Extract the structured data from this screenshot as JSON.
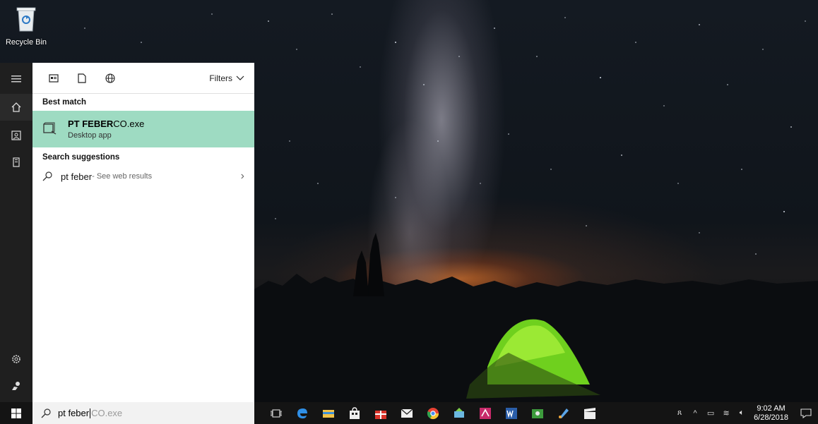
{
  "desktop": {
    "recycle_bin_label": "Recycle Bin"
  },
  "search_panel": {
    "toolbar": {
      "filters_label": "Filters",
      "icons": [
        "apps-icon",
        "documents-icon",
        "web-icon"
      ]
    },
    "best_match": {
      "section_title": "Best match",
      "app_name_bold": "PT FEBER",
      "app_name_rest": "CO.exe",
      "app_type": "Desktop app"
    },
    "suggestions": {
      "section_title": "Search suggestions",
      "items": [
        {
          "query": "pt feber",
          "suffix": " - See web results"
        }
      ]
    }
  },
  "left_rail": {
    "icons": [
      "hamburger-icon",
      "home-icon",
      "contact-card-icon",
      "tower-icon",
      "settings-icon",
      "feedback-icon"
    ]
  },
  "taskbar": {
    "search_typed": "pt feber",
    "search_autocomplete": "CO.exe",
    "apps": [
      "task-view-icon",
      "edge-icon",
      "file-explorer-icon",
      "store-icon",
      "gift-icon",
      "mail-icon",
      "chrome-icon",
      "app-icon",
      "acrobat-icon",
      "word-icon",
      "green-app-icon",
      "paint-icon",
      "clapper-icon"
    ],
    "tray": {
      "time": "9:02 AM",
      "date": "6/28/2018"
    }
  },
  "colors": {
    "best_match_highlight": "#9edbc2",
    "taskbar": "#141414",
    "rail": "#1f1f1f"
  }
}
